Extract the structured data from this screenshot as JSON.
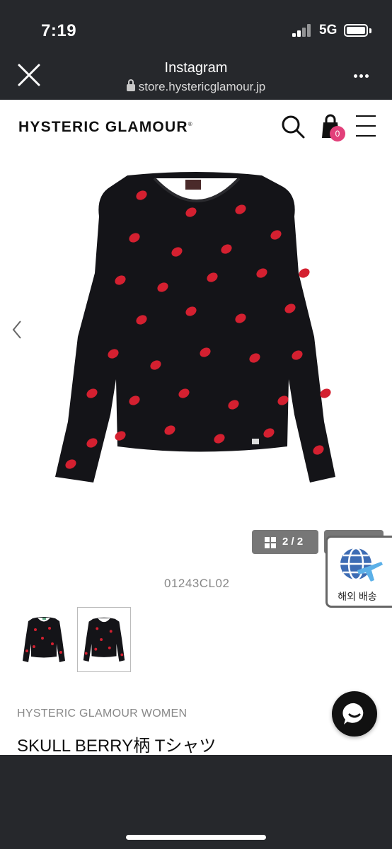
{
  "status_bar": {
    "time": "7:19",
    "network": "5G"
  },
  "browser": {
    "title": "Instagram",
    "url": "store.hystericglamour.jp"
  },
  "header": {
    "logo": "HYSTERIC GLAMOUR",
    "cart_count": "0"
  },
  "gallery": {
    "counter": "2 / 2"
  },
  "overseas_shipping": {
    "label": "해외 배송"
  },
  "product": {
    "sku": "01243CL02",
    "brand_line": "HYSTERIC GLAMOUR WOMEN",
    "name": "SKULL BERRY柄 Tシャツ"
  },
  "colors": {
    "bar": "#26282c",
    "badge": "#e2407a",
    "berry": "#d42030",
    "shirt": "#141418"
  },
  "icons": [
    "close-icon",
    "lock-icon",
    "more-icon",
    "search-icon",
    "cart-icon",
    "menu-icon",
    "chevron-left-icon",
    "grid-icon",
    "globe-plane-icon",
    "chat-icon"
  ]
}
